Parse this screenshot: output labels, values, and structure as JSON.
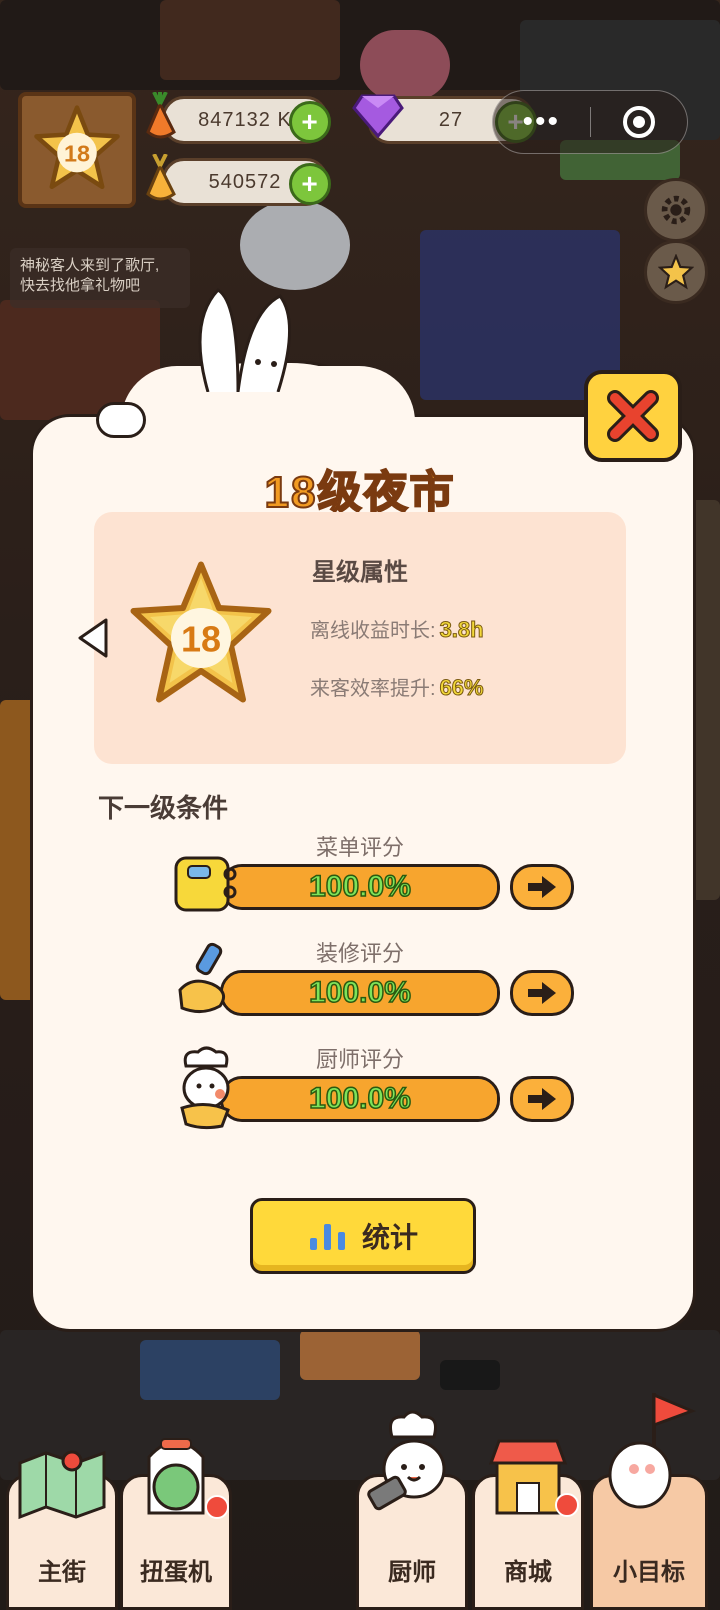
{
  "hud": {
    "level_badge_number": "18",
    "carrot_amount": "847132 K",
    "gold_carrot_amount": "540572",
    "gem_amount": "27",
    "notice_line1": "神秘客人来到了歌厅,",
    "notice_line2": "快去找他拿礼物吧"
  },
  "modal": {
    "title": "18级夜市",
    "star_number": "18",
    "attr_title": "星级属性",
    "attrs": [
      {
        "label": "离线收益时长:",
        "value": "3.8h"
      },
      {
        "label": "来客效率提升:",
        "value": "66%"
      }
    ],
    "next_title": "下一级条件",
    "scores": [
      {
        "label": "菜单评分",
        "value_text": "100.0%",
        "progress": 1.0,
        "icon": "menu-book-icon"
      },
      {
        "label": "装修评分",
        "value_text": "100.0%",
        "progress": 1.0,
        "icon": "paint-roller-icon"
      },
      {
        "label": "厨师评分",
        "value_text": "100.0%",
        "progress": 1.0,
        "icon": "chef-bunny-icon"
      }
    ],
    "stat_button": "统计"
  },
  "nav": {
    "tabs": [
      {
        "label": "主街",
        "icon": "map-icon"
      },
      {
        "label": "扭蛋机",
        "icon": "gacha-machine-icon"
      },
      {
        "label": "厨师",
        "icon": "chef-icon"
      },
      {
        "label": "商城",
        "icon": "shop-icon"
      },
      {
        "label": "小目标",
        "icon": "goal-flag-icon",
        "active": true
      }
    ]
  },
  "colors": {
    "title_orange": "#f29b22",
    "bar_orange": "#fbb03b",
    "percent_green": "#7ee35a",
    "attr_value_yellow": "#f3d93a",
    "close_button_yellow": "#ffd23f",
    "close_x_red": "#e8432e"
  }
}
